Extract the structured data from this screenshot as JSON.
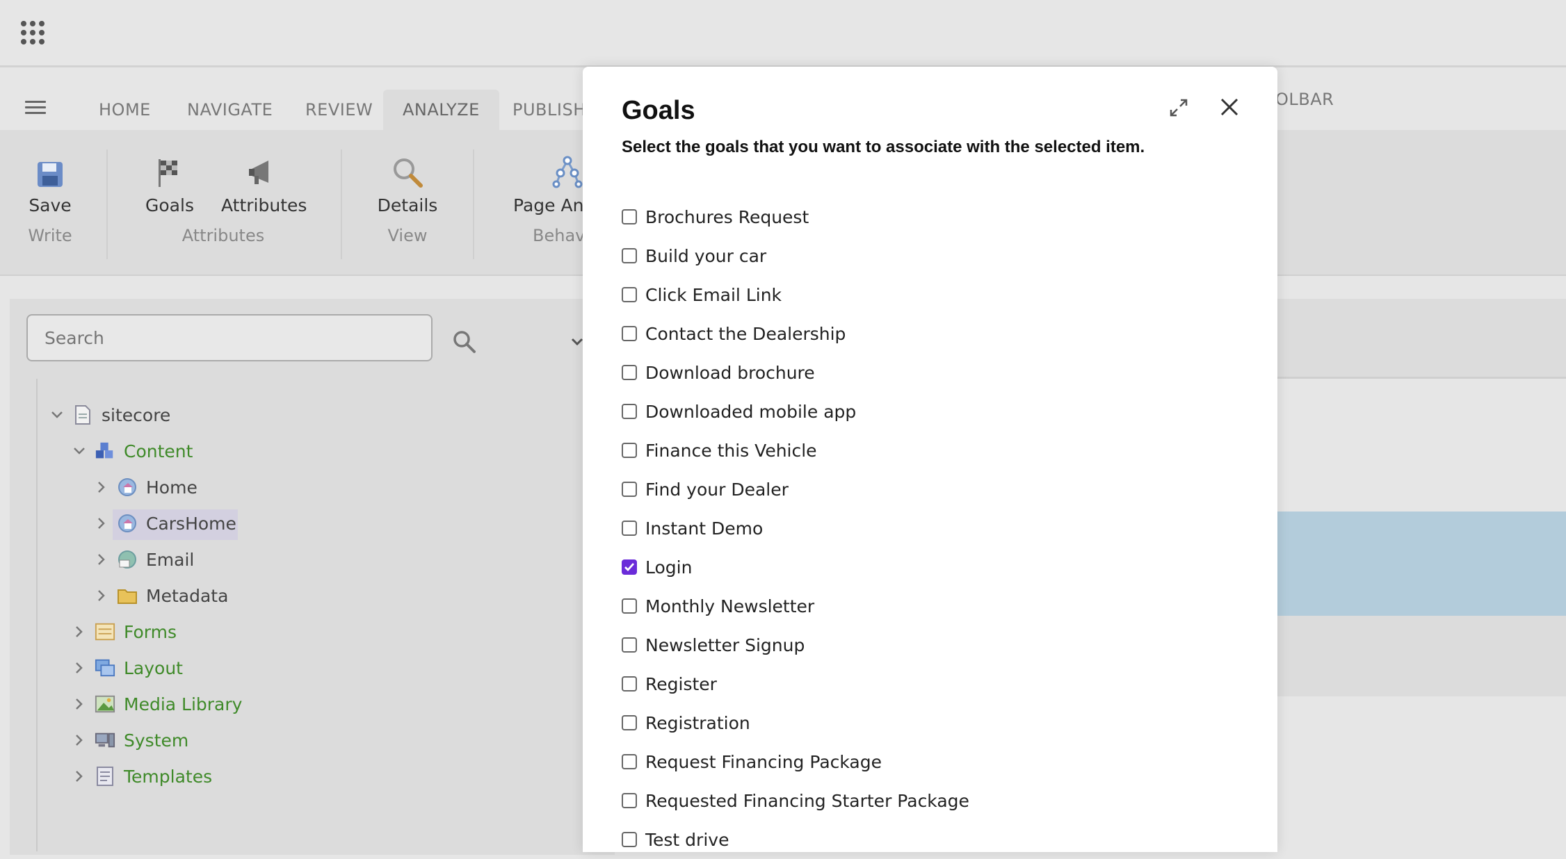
{
  "tabs": [
    "HOME",
    "NAVIGATE",
    "REVIEW",
    "ANALYZE",
    "PUBLISH"
  ],
  "active_tab": "ANALYZE",
  "toolbar_tab_fragment": "OLBAR",
  "ribbon": {
    "save": "Save",
    "write": "Write",
    "goals": "Goals",
    "attributes": "Attributes",
    "attributes_group": "Attributes",
    "details": "Details",
    "view": "View",
    "page_analyzer": "Page Ana",
    "behavior": "Behav"
  },
  "search": {
    "placeholder": "Search"
  },
  "tree": {
    "root": "sitecore",
    "content": "Content",
    "home": "Home",
    "carshome": "CarsHome",
    "email": "Email",
    "metadata": "Metadata",
    "forms": "Forms",
    "layout": "Layout",
    "media_library": "Media Library",
    "system": "System",
    "templates": "Templates"
  },
  "modal": {
    "title": "Goals",
    "subtitle": "Select the goals that you want to associate with the selected item.",
    "goals": [
      {
        "label": "Brochures Request",
        "checked": false
      },
      {
        "label": "Build your car",
        "checked": false
      },
      {
        "label": "Click Email Link",
        "checked": false
      },
      {
        "label": "Contact the Dealership",
        "checked": false
      },
      {
        "label": "Download brochure",
        "checked": false
      },
      {
        "label": "Downloaded mobile app",
        "checked": false
      },
      {
        "label": "Finance this Vehicle",
        "checked": false
      },
      {
        "label": "Find your Dealer",
        "checked": false
      },
      {
        "label": "Instant Demo",
        "checked": false
      },
      {
        "label": "Login",
        "checked": true
      },
      {
        "label": "Monthly Newsletter",
        "checked": false
      },
      {
        "label": "Newsletter Signup",
        "checked": false
      },
      {
        "label": "Register",
        "checked": false
      },
      {
        "label": "Registration",
        "checked": false
      },
      {
        "label": "Request Financing Package",
        "checked": false
      },
      {
        "label": "Requested Financing Starter Package",
        "checked": false
      },
      {
        "label": "Test drive",
        "checked": false
      }
    ]
  },
  "colors": {
    "checkbox_checked": "#6a2bd9",
    "tree_green": "#3f8a29",
    "selected_row": "#d3d0e0"
  }
}
